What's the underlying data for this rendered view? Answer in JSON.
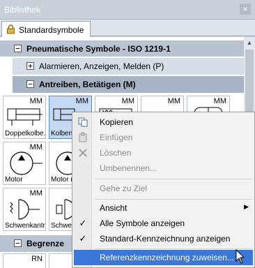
{
  "window": {
    "title": "Bibliothek",
    "close_glyph": "×"
  },
  "tab": {
    "label": "Standardsymbole",
    "icon": "lock-icon"
  },
  "tree": {
    "row1": {
      "toggle": "−",
      "label": "Pneumatische Symbole - ISO 1219-1"
    },
    "row2": {
      "toggle": "+",
      "label": "Alarmieren, Anzeigen, Melden (P)"
    },
    "row3": {
      "toggle": "−",
      "label": "Antreiben, Betätigen (M)"
    },
    "row4": {
      "toggle": "−",
      "label": "Begrenze"
    }
  },
  "symbols": [
    {
      "tag": "MM",
      "label": "Doppelkolbe..."
    },
    {
      "tag": "MM",
      "label": "Kolbens"
    },
    {
      "tag": "MM",
      "label": ""
    },
    {
      "tag": "MM",
      "label": ""
    },
    {
      "tag": "MM",
      "label": ""
    },
    {
      "tag": "MM",
      "label": "Motor"
    },
    {
      "tag": "MM",
      "label": "Motor n"
    },
    {
      "tag": "MM",
      "label": "Schwenkantr..."
    },
    {
      "tag": "MM",
      "label": "Schwenkant"
    },
    {
      "tag": "RN",
      "label": ""
    },
    {
      "tag": "",
      "label": ""
    }
  ],
  "context_menu": {
    "items": [
      {
        "label": "Kopieren",
        "icon": "copy-icon",
        "enabled": true
      },
      {
        "label": "Einfügen",
        "icon": "paste-icon",
        "enabled": false
      },
      {
        "label": "Löschen",
        "icon": "delete-icon",
        "enabled": false
      },
      {
        "label": "Umbenennen...",
        "enabled": false
      },
      {
        "label": "Gehe zu Ziel",
        "enabled": false
      },
      {
        "label": "Ansicht",
        "has_submenu": true,
        "enabled": true
      },
      {
        "label": "Alle Symbole anzeigen",
        "checked": true,
        "enabled": true
      },
      {
        "label": "Standard-Kennzeichnung anzeigen",
        "checked": true,
        "enabled": true
      },
      {
        "label": "Referenzkennzeichnung zuweisen...",
        "enabled": true,
        "highlighted": true
      }
    ],
    "check_glyph": "✓",
    "submenu_glyph": "▶"
  },
  "colors": {
    "highlight": "#3b76d9",
    "title_bar": "#c9d0da",
    "selected_cell": "#c6d9f2"
  }
}
